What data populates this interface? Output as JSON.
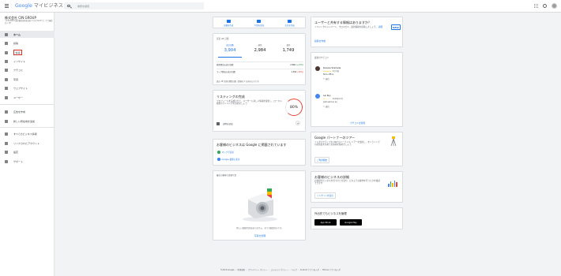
{
  "header": {
    "logo_g": "Google",
    "logo_rest": " マイビジネス",
    "search_placeholder": "場所を検索"
  },
  "sidebar": {
    "business_name": "株式会社 CIN GROUP",
    "business_address": "〒150-0013 東京都渋谷区恵比寿 1丁目 19-15 ウノサワ東急ビル 3F",
    "items": [
      {
        "label": "ホーム",
        "icon": "home-icon"
      },
      {
        "label": "投稿",
        "icon": "post-icon"
      },
      {
        "label": "情報",
        "icon": "store-icon"
      },
      {
        "label": "インサイト",
        "icon": "insights-icon"
      },
      {
        "label": "クチコミ",
        "icon": "star-icon"
      },
      {
        "label": "写真",
        "icon": "photo-icon"
      },
      {
        "label": "ウェブサイト",
        "icon": "website-icon"
      },
      {
        "label": "ユーザー",
        "icon": "user-icon"
      },
      {
        "label": "広告を作成",
        "icon": "ads-icon"
      },
      {
        "label": "新しい所在地を追加",
        "icon": "location-icon"
      },
      {
        "label": "すべてのビジネス情報",
        "icon": "list-icon"
      },
      {
        "label": "リンクされたアカウント",
        "icon": "link-icon"
      },
      {
        "label": "設定",
        "icon": "gear-icon"
      },
      {
        "label": "サポート",
        "icon": "help-icon"
      }
    ]
  },
  "actions": [
    {
      "label": "投稿を作成"
    },
    {
      "label": "写真を追加"
    },
    {
      "label": "広告を作成"
    }
  ],
  "stats": {
    "header": "直近 28 日間",
    "items": [
      {
        "label": "表示回数",
        "value": "3,904"
      },
      {
        "label": "検索",
        "value": "2,984"
      },
      {
        "label": "操作",
        "value": "1,749"
      }
    ],
    "rows": [
      {
        "label": "検索経由の表示回数",
        "value": "2,966",
        "delta": "(+13%)",
        "trend": "up"
      },
      {
        "label": "マップ経由の表示回数",
        "value": "1,304",
        "delta": "(-10%)",
        "trend": "down"
      }
    ],
    "note": "過去 28 日間の閲覧回数（数値は 1 日前のものです）"
  },
  "completeness": {
    "title": "リスティングの完成",
    "desc": "プロフィールを完成させて、ユーザーに詳しい情報を提供し、ローカル検索のランキングを高めましょう",
    "percent": "80%",
    "item": "説明を追加"
  },
  "connected": {
    "title": "お客様のビジネスは Google に掲載されています",
    "links": [
      "マップで表示",
      "Google 検索に表示"
    ]
  },
  "photos": {
    "title": "最近の顧客の投稿写真",
    "text": "新しい投稿写真はありません。すべて確認済みです。",
    "link": "写真を管理"
  },
  "share": {
    "title": "ユーザーと共有する情報はありますか？",
    "desc": "イベントやキャンペーン、クロスセル、最新情報を投稿しましょう。",
    "desc_link": "詳細",
    "link": "投稿を作成",
    "badge": "NEW"
  },
  "reviews": {
    "title": "最新のクチコミ",
    "items": [
      {
        "name": "Kosuke Shimada",
        "stars": "★★★★★",
        "date": "4か月前",
        "text": "Nice office",
        "reply": "返信"
      },
      {
        "name": "Lai Roy",
        "stars": "★☆☆☆☆",
        "date": "2018年12月",
        "text": "Just said so so",
        "reply": "返信"
      }
    ],
    "more": "クチコミを管理"
  },
  "partners": {
    "title": "Google パートナーのツアー",
    "desc": "インタラクティブな 360°のバーチャル ツアーを使用し、オンラインでの認知度を高めてお客様を集めましょう",
    "button": "ご利用開始"
  },
  "details": {
    "title": "お客様のビジネスの詳細",
    "desc": "お客様がビジネスを見つけた方法や、どのような操作を行ったかを確認できます",
    "button": "インサイトを表示"
  },
  "mobile": {
    "title": "外出先でもビジネスを管理",
    "appstore": "App Store",
    "googleplay": "Google Play"
  },
  "footer": "©2019 Google ・ 利用規約 ・ プライバシー ポリシー ・ コンテンツ ポリシー ・ ヘルプ ・ Android アプリを入手 ・ iPhone アプリを入手",
  "colors": {
    "accent": "#1a73e8",
    "highlight": "#d93025"
  }
}
